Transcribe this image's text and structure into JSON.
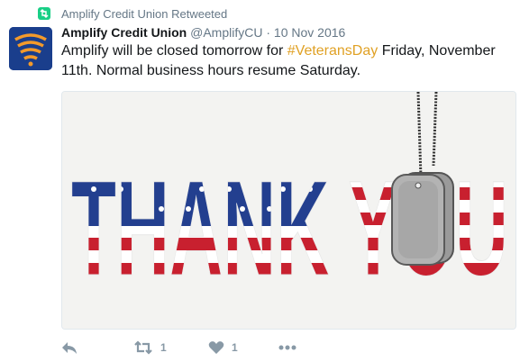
{
  "retweet_context": {
    "icon": "retweet-badge-icon",
    "label": "Amplify Credit Union Retweeted"
  },
  "tweet": {
    "avatar_icon": "amplify-logo-icon",
    "author_name": "Amplify Credit Union",
    "author_handle": "@AmplifyCU",
    "separator": "·",
    "timestamp": "10 Nov 2016",
    "text_before": "Amplify will be closed tomorrow for ",
    "hashtag": "#VeteransDay",
    "text_after": " Friday, November 11th. Normal business hours resume Saturday.",
    "image_text": "THANK YOU"
  },
  "actions": {
    "reply_icon": "reply-icon",
    "retweet_icon": "retweet-icon",
    "retweet_count": "1",
    "like_icon": "heart-icon",
    "like_count": "1",
    "more_icon": "more-icon"
  },
  "colors": {
    "hashtag": "#e0a125",
    "retweet_badge": "#19cf86",
    "muted": "#657786",
    "action_gray": "#8899a6",
    "flag_blue": "#233f8f",
    "flag_red": "#c8202f",
    "avatar_blue": "#1a3e8c",
    "avatar_orange": "#f39a2b"
  }
}
